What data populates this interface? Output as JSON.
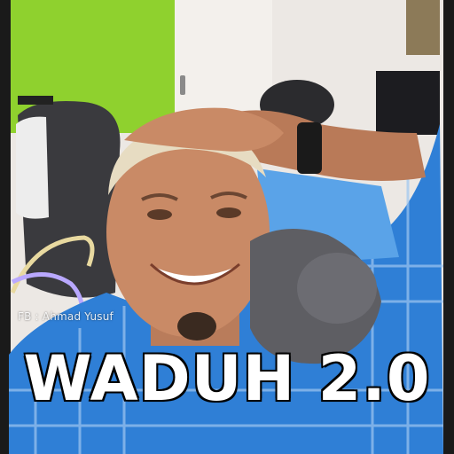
{
  "photo": {
    "watermark": "FB : Ahmad Yusuf",
    "caption": "WADUH 2.0",
    "colors": {
      "wall_green": "#8fd12e",
      "wall_white": "#ece8e4",
      "skin": "#c98a66",
      "hair": "#e7dcc2",
      "shirt_blue": "#2f7fd6",
      "kitten_gray": "#5e5e63",
      "caption_text": "#ffffff",
      "caption_outline": "#000000"
    }
  }
}
